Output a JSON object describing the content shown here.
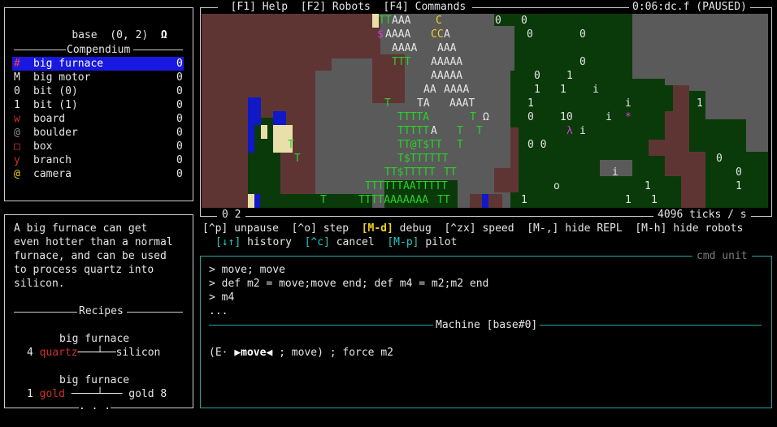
{
  "base_panel": {
    "name": "base",
    "coords": "(0, 2)",
    "omega": "Ω"
  },
  "compendium": {
    "title": "Compendium",
    "items": [
      {
        "glyph": "#",
        "glyph_color": "#ff3a3a",
        "name": "big furnace",
        "count": "0",
        "selected": true
      },
      {
        "glyph": "M",
        "glyph_color": "#e5e5e5",
        "name": "big motor",
        "count": "0"
      },
      {
        "glyph": "0",
        "glyph_color": "#e5e5e5",
        "name": "bit (0)",
        "count": "0"
      },
      {
        "glyph": "1",
        "glyph_color": "#e5e5e5",
        "name": "bit (1)",
        "count": "0"
      },
      {
        "glyph": "w",
        "glyph_color": "#d0302a",
        "name": "board",
        "count": "0"
      },
      {
        "glyph": "@",
        "glyph_color": "#8c8c8c",
        "name": "boulder",
        "count": "0"
      },
      {
        "glyph": "□",
        "glyph_color": "#d0302a",
        "name": "box",
        "count": "0"
      },
      {
        "glyph": "y",
        "glyph_color": "#d0302a",
        "name": "branch",
        "count": "0"
      },
      {
        "glyph": "@",
        "glyph_color": "#f0d020",
        "name": "camera",
        "count": "0"
      }
    ]
  },
  "description": {
    "lines": [
      "A big furnace can get",
      "even hotter than a normal",
      "furnace, and can be used",
      "to process quartz into",
      "silicon."
    ],
    "recipes_title": "Recipes",
    "recipe1": {
      "machine": "big furnace",
      "qty_in": "4",
      "input": "quartz",
      "arrow": "───┴──",
      "output": "silicon"
    },
    "recipe2": {
      "machine": "big furnace",
      "qty_in": "1",
      "input": "gold",
      "arrow": "────┴───",
      "output": "gold 8"
    },
    "more": ". . ."
  },
  "top_menu": {
    "help": "[F1] Help",
    "robots": "[F2] Robots",
    "commands": "[F4] Commands",
    "status": "0:06:dc.f (PAUSED)"
  },
  "world_status": {
    "coords": "0 2",
    "speed": "4096 ticks / s"
  },
  "keybinds": {
    "row1": [
      {
        "key": "[^p]",
        "label": "unpause",
        "key_color": "#e5e5e5",
        "bold": false
      },
      {
        "key": "[^o]",
        "label": "step",
        "key_color": "#e5e5e5",
        "bold": false
      },
      {
        "key": "[M-d]",
        "label": "debug",
        "key_color": "#f0d020",
        "bold": true
      },
      {
        "key": "[^zx]",
        "label": "speed",
        "key_color": "#e5e5e5",
        "bold": false
      },
      {
        "key": "[M-,]",
        "label": "hide REPL",
        "key_color": "#e5e5e5",
        "bold": false
      },
      {
        "key": "[M-h]",
        "label": "hide robots",
        "key_color": "#e5e5e5",
        "bold": false
      }
    ],
    "row2": [
      {
        "key": "[↓↑]",
        "label": "history",
        "key_color": "#28c8c8"
      },
      {
        "key": "[^c]",
        "label": "cancel",
        "key_color": "#28c8c8"
      },
      {
        "key": "[M-p]",
        "label": "pilot",
        "key_color": "#28c8c8"
      }
    ]
  },
  "repl": {
    "title": "cmd unit",
    "lines": [
      "> move; move",
      "> def m2 = move;move end; def m4 = m2;m2 end",
      "> m4",
      "..."
    ],
    "machine_title": "Machine [base#0]",
    "machine_prefix": "(E· ",
    "machine_focus": "▶move◀",
    "machine_suffix": " ; move) ; force m2"
  },
  "colors": {
    "dirt": "#5f3534",
    "stone": "#5a5a5a",
    "tree": "#0a3a0a",
    "water": "#1018c8",
    "sand": "#e8e0a8",
    "selection": "#1818e0"
  }
}
